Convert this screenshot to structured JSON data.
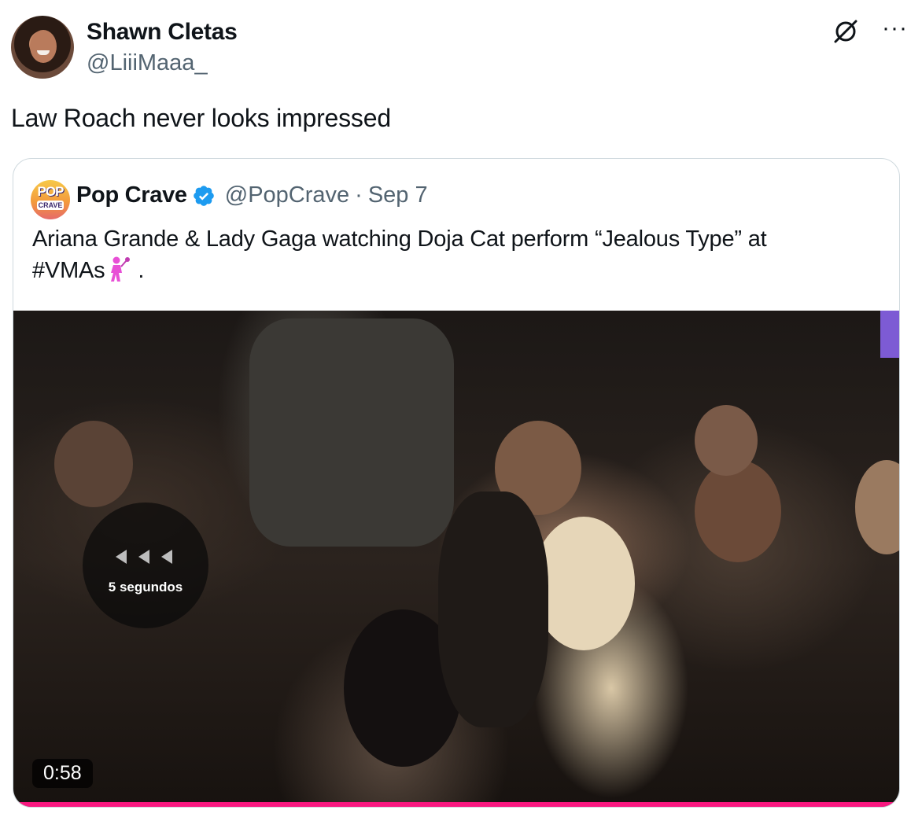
{
  "post": {
    "author_name": "Shawn Cletas",
    "author_handle": "@LiiiMaaa_",
    "text": "Law Roach never looks impressed",
    "icons": {
      "grok": "grok-icon",
      "more": "···"
    }
  },
  "quote": {
    "author_name": "Pop Crave",
    "author_handle": "@PopCrave",
    "dot": "·",
    "date": "Sep 7",
    "verified": true,
    "avatar_text_top": "POP",
    "avatar_text_bottom": "CRAVE",
    "text_line1": "Ariana Grande & Lady Gaga watching Doja Cat perform “Jealous Type” at",
    "text_line2": "#VMAs",
    "text_suffix": " .",
    "emoji": "singer-icon"
  },
  "video": {
    "seek_label": "5 segundos",
    "duration": "0:58",
    "progress": 1.0,
    "progress_color": "#f91880",
    "accent_blue": "#1d9bf0"
  }
}
